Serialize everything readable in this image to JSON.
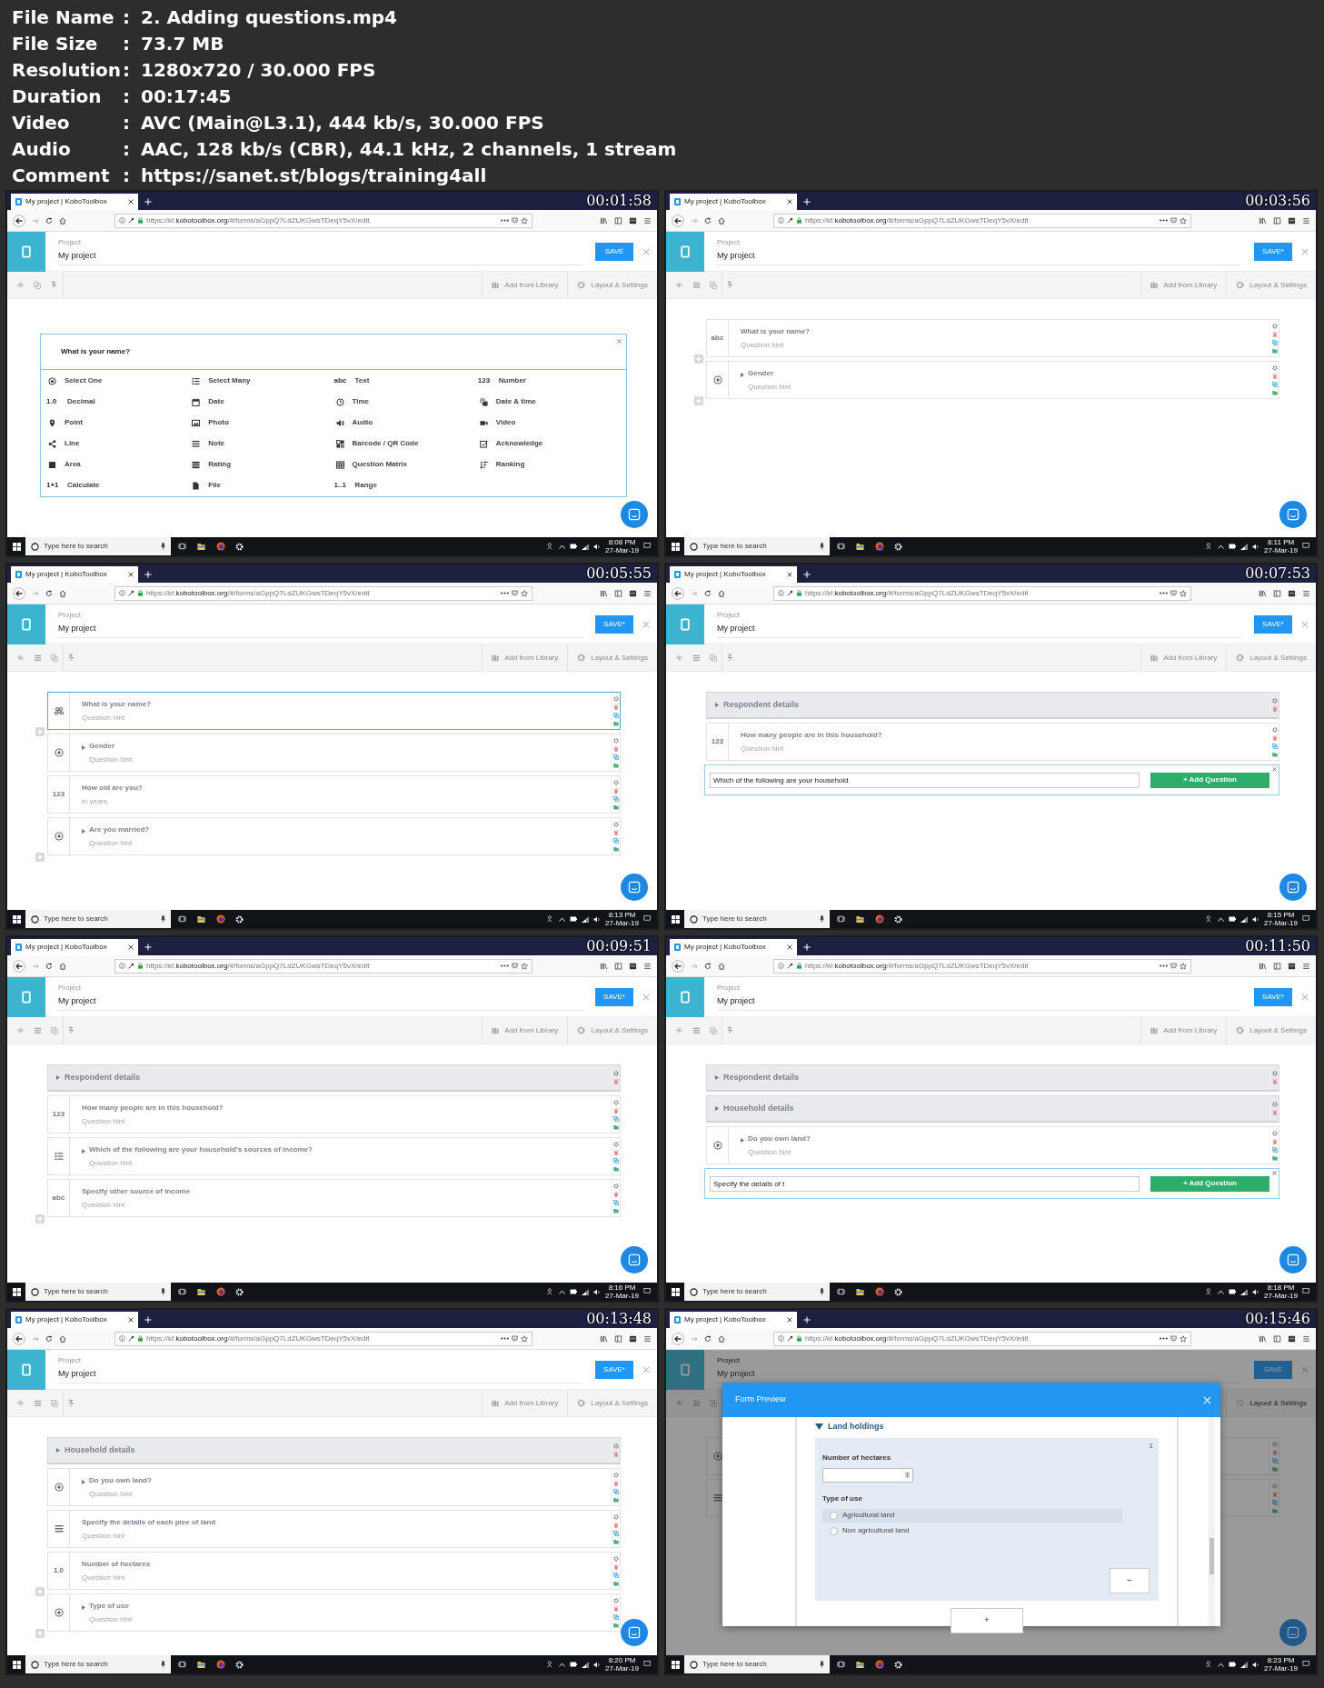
{
  "info": [
    {
      "label": "File Name",
      "value": "2. Adding questions.mp4"
    },
    {
      "label": "File Size",
      "value": "73.7 MB"
    },
    {
      "label": "Resolution",
      "value": "1280x720 / 30.000 FPS"
    },
    {
      "label": "Duration",
      "value": "00:17:45"
    },
    {
      "label": "Video",
      "value": "AVC (Main@L3.1), 444 kb/s, 30.000 FPS"
    },
    {
      "label": "Audio",
      "value": "AAC, 128 kb/s (CBR), 44.1 kHz, 2 channels, 1 stream"
    },
    {
      "label": "Comment",
      "value": "https://sanet.st/blogs/training4all"
    }
  ],
  "separator": ":",
  "frames": [
    {
      "timestamp": "00:01:58",
      "tab_title": "My project | KoboToolbox",
      "url": "https://kf.**kobotoolbox.org**/#/forms/aGppQ7LdZUKGwsTDeqY5vX/edit",
      "project_label": "Project",
      "project_name": "My project",
      "save_label": "SAVE",
      "outline_button": false,
      "toolbar": [
        {
          "kind": "library",
          "label": "Add from Library"
        },
        {
          "kind": "settings",
          "label": "Layout & Settings"
        }
      ],
      "search_placeholder": "Type here to search",
      "clock": "8:08 PM",
      "date": "27-Mar-19",
      "content": {
        "kind": "picker",
        "question": "What is your name?",
        "types": [
          {
            "kind": "select_one",
            "label": "Select One"
          },
          {
            "kind": "select_many",
            "label": "Select Many"
          },
          {
            "glyph": "abc",
            "label": "Text"
          },
          {
            "glyph": "123",
            "label": "Number"
          },
          {
            "glyph": "1.0",
            "label": "Decimal"
          },
          {
            "kind": "date",
            "label": "Date"
          },
          {
            "kind": "time",
            "label": "Time"
          },
          {
            "kind": "datetime",
            "label": "Date & time"
          },
          {
            "kind": "geopoint",
            "label": "Point"
          },
          {
            "kind": "image",
            "label": "Photo"
          },
          {
            "kind": "audio",
            "label": "Audio"
          },
          {
            "kind": "video",
            "label": "Video"
          },
          {
            "kind": "geotrace",
            "label": "Line"
          },
          {
            "kind": "note",
            "label": "Note"
          },
          {
            "kind": "barcode",
            "label": "Barcode / QR Code"
          },
          {
            "kind": "acknowledge",
            "label": "Acknowledge"
          },
          {
            "kind": "geoshape",
            "label": "Area"
          },
          {
            "kind": "rating",
            "label": "Rating"
          },
          {
            "kind": "matrix",
            "label": "Question Matrix"
          },
          {
            "kind": "rank",
            "label": "Ranking"
          },
          {
            "glyph": "1+1",
            "label": "Calculate"
          },
          {
            "kind": "file",
            "label": "File"
          },
          {
            "glyph": "1..1",
            "label": "Range"
          }
        ]
      }
    },
    {
      "timestamp": "00:03:56",
      "tab_title": "My project | KoboToolbox",
      "url": "https://kf.**kobotoolbox.org**/#/forms/aGppQ7LdZUKGwsTDeqY5vX/edit",
      "project_label": "Project",
      "project_name": "My project",
      "save_label": "SAVE*",
      "outline_button": true,
      "toolbar": [
        {
          "kind": "library",
          "label": "Add from Library"
        },
        {
          "kind": "settings",
          "label": "Layout & Settings"
        }
      ],
      "search_placeholder": "Type here to search",
      "clock": "8:11 PM",
      "date": "27-Mar-19",
      "content": {
        "kind": "list",
        "items": [
          {
            "kind": "text",
            "glyph": "abc",
            "title": "What is your name?",
            "hint": "Question hint",
            "expandable": false,
            "selected": false,
            "add_after": true
          },
          {
            "kind": "select_one",
            "title": "Gender",
            "hint": "Question hint",
            "expandable": true,
            "selected": false,
            "add_after": true
          }
        ]
      }
    },
    {
      "timestamp": "00:05:55",
      "tab_title": "My project | KoboToolbox",
      "url": "https://kf.**kobotoolbox.org**/#/forms/aGppQ7LdZUKGwsTDeqY5vX/edit",
      "project_label": "Project",
      "project_name": "My project",
      "save_label": "SAVE*",
      "outline_button": true,
      "toolbar": [
        {
          "kind": "library",
          "label": "Add from Library"
        },
        {
          "kind": "settings",
          "label": "Layout & Settings"
        }
      ],
      "search_placeholder": "Type here to search",
      "clock": "8:13 PM",
      "date": "27-Mar-19",
      "content": {
        "kind": "list",
        "items": [
          {
            "kind": "loading",
            "title": "What is your name?",
            "hint": "Question hint",
            "expandable": false,
            "selected": true,
            "add_after": true
          },
          {
            "kind": "select_one",
            "title": "Gender",
            "hint": "Question hint",
            "expandable": true,
            "selected": false,
            "add_after": false
          },
          {
            "kind": "integer",
            "glyph": "123",
            "title": "How old are you?",
            "hint": "in years",
            "expandable": false,
            "selected": false,
            "add_after": false
          },
          {
            "kind": "select_one",
            "title": "Are you married?",
            "hint": "Question hint",
            "expandable": true,
            "selected": false,
            "add_after": true
          }
        ]
      }
    },
    {
      "timestamp": "00:07:53",
      "tab_title": "My project | KoboToolbox",
      "url": "https://kf.**kobotoolbox.org**/#/forms/aGppQ7LdZUKGwsTDeqY5vX/edit",
      "project_label": "Project",
      "project_name": "My project",
      "save_label": "SAVE*",
      "outline_button": true,
      "toolbar": [
        {
          "kind": "library",
          "label": "Add from Library"
        },
        {
          "kind": "settings",
          "label": "Layout & Settings"
        }
      ],
      "search_placeholder": "Type here to search",
      "clock": "8:15 PM",
      "date": "27-Mar-19",
      "content": {
        "kind": "list",
        "items": [
          {
            "kind": "group",
            "title": "Respondent details"
          },
          {
            "kind": "integer",
            "glyph": "123",
            "title": "How many people are in this household?",
            "hint": "Question hint",
            "expandable": false,
            "selected": false,
            "add_after": false
          },
          {
            "kind": "adder",
            "value": "Which of the following are your household",
            "button": "+ Add Question"
          }
        ]
      }
    },
    {
      "timestamp": "00:09:51",
      "tab_title": "My project | KoboToolbox",
      "url": "https://kf.**kobotoolbox.org**/#/forms/aGppQ7LdZUKGwsTDeqY5vX/edit",
      "project_label": "Project",
      "project_name": "My project",
      "save_label": "SAVE*",
      "outline_button": true,
      "toolbar": [
        {
          "kind": "library",
          "label": "Add from Library"
        },
        {
          "kind": "settings",
          "label": "Layout & Settings"
        }
      ],
      "search_placeholder": "Type here to search",
      "clock": "8:16 PM",
      "date": "27-Mar-19",
      "content": {
        "kind": "list",
        "items": [
          {
            "kind": "group",
            "title": "Respondent details"
          },
          {
            "kind": "integer",
            "glyph": "123",
            "title": "How many people are in this household?",
            "hint": "Question hint",
            "expandable": false,
            "selected": false,
            "add_after": false
          },
          {
            "kind": "select_many",
            "title": "Which of the following are your household's sources of income?",
            "hint": "Question hint",
            "expandable": true,
            "selected": false,
            "add_after": false
          },
          {
            "kind": "text",
            "glyph": "abc",
            "title": "Specify other source of income",
            "hint": "Question hint",
            "expandable": false,
            "selected": false,
            "add_after": true
          }
        ]
      }
    },
    {
      "timestamp": "00:11:50",
      "tab_title": "My project | KoboToolbox",
      "url": "https://kf.**kobotoolbox.org**/#/forms/aGppQ7LdZUKGwsTDeqY5vX/edit",
      "project_label": "Project",
      "project_name": "My project",
      "save_label": "SAVE*",
      "outline_button": true,
      "toolbar": [
        {
          "kind": "library",
          "label": "Add from Library"
        },
        {
          "kind": "settings",
          "label": "Layout & Settings"
        }
      ],
      "search_placeholder": "Type here to search",
      "clock": "8:18 PM",
      "date": "27-Mar-19",
      "content": {
        "kind": "list",
        "items": [
          {
            "kind": "group",
            "title": "Respondent details"
          },
          {
            "kind": "group",
            "title": "Household details"
          },
          {
            "kind": "select_one",
            "title": "Do you own land?",
            "hint": "Question hint",
            "expandable": true,
            "selected": false,
            "add_after": false
          },
          {
            "kind": "adder",
            "value": "Specify the details of t",
            "button": "+ Add Question"
          }
        ]
      }
    },
    {
      "timestamp": "00:13:48",
      "tab_title": "My project | KoboToolbox",
      "url": "https://kf.**kobotoolbox.org**/#/forms/aGppQ7LdZUKGwsTDeqY5vX/edit",
      "project_label": "Project",
      "project_name": "My project",
      "save_label": "SAVE*",
      "outline_button": true,
      "toolbar": [
        {
          "kind": "library",
          "label": "Add from Library"
        },
        {
          "kind": "settings",
          "label": "Layout & Settings"
        }
      ],
      "search_placeholder": "Type here to search",
      "clock": "8:20 PM",
      "date": "27-Mar-19",
      "content": {
        "kind": "list",
        "items": [
          {
            "kind": "group",
            "title": "Household details"
          },
          {
            "kind": "select_one",
            "title": "Do you own land?",
            "hint": "Question hint",
            "expandable": true,
            "selected": false,
            "add_after": false
          },
          {
            "kind": "note",
            "title": "Specify the details of each piee of land",
            "hint": "Question hint",
            "expandable": false,
            "selected": false,
            "add_after": false
          },
          {
            "kind": "decimal",
            "glyph": "1.0",
            "title": "Number of hectares",
            "hint": "Question hint",
            "expandable": false,
            "selected": false,
            "add_after": true
          },
          {
            "kind": "select_one",
            "title": "Type of use",
            "hint": "Question hint",
            "expandable": true,
            "selected": false,
            "add_after": true
          }
        ]
      }
    },
    {
      "timestamp": "00:15:46",
      "tab_title": "My project | KoboToolbox",
      "url": "https://kf.**kobotoolbox.org**/#/forms/aGppQ7LdZUKGwsTDeqY5vX/edit",
      "project_label": "Project",
      "project_name": "My project",
      "save_label": "SAVE",
      "outline_button": true,
      "toolbar": [
        {
          "kind": "settings",
          "label": "Layout & Settings"
        }
      ],
      "search_placeholder": "Type here to search",
      "clock": "8:23 PM",
      "date": "27-Mar-19",
      "content": {
        "kind": "list",
        "items": [
          {
            "kind": "select_one",
            "expandable": false,
            "selected": false,
            "add_after": false
          },
          {
            "kind": "note",
            "expandable": false,
            "selected": false,
            "add_after": false
          }
        ]
      },
      "preview": {
        "title": "Form Preview",
        "group": "Land holdings",
        "repeat_index": "1",
        "fields": [
          {
            "kind": "number",
            "label": "Number of hectares"
          },
          {
            "kind": "radio",
            "label": "Type of use",
            "options": [
              {
                "label": "Agricultural land",
                "hovered": true,
                "selected": false
              },
              {
                "label": "Non agricultural land",
                "hovered": false,
                "selected": false
              }
            ]
          }
        ],
        "remove_button": "−",
        "add_button": "+"
      }
    }
  ]
}
